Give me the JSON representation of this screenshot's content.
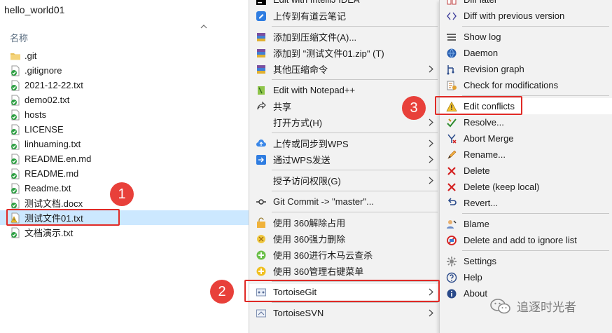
{
  "explorer": {
    "title": "hello_world01",
    "column_name": "名称",
    "files": [
      {
        "name": ".git",
        "icon": "folder-icon"
      },
      {
        "name": ".gitignore",
        "icon": "git-ok-icon"
      },
      {
        "name": "2021-12-22.txt",
        "icon": "git-ok-icon"
      },
      {
        "name": "demo02.txt",
        "icon": "git-ok-icon"
      },
      {
        "name": "hosts",
        "icon": "git-ok-icon"
      },
      {
        "name": "LICENSE",
        "icon": "git-ok-icon"
      },
      {
        "name": "linhuaming.txt",
        "icon": "git-ok-icon"
      },
      {
        "name": "README.en.md",
        "icon": "git-ok-icon"
      },
      {
        "name": "README.md",
        "icon": "git-ok-icon"
      },
      {
        "name": "Readme.txt",
        "icon": "git-ok-icon"
      },
      {
        "name": "测试文档.docx",
        "icon": "git-ok-icon"
      },
      {
        "name": "测试文件01.txt",
        "icon": "git-conflict-icon",
        "selected": true
      },
      {
        "name": "文档演示.txt",
        "icon": "git-ok-icon"
      }
    ]
  },
  "context_menu": {
    "items": [
      {
        "label": "Edit with IntelliJ IDEA",
        "icon": "intellij-icon"
      },
      {
        "label": "上传到有道云笔记",
        "icon": "youdao-icon"
      },
      {
        "sep": true
      },
      {
        "label": "添加到压缩文件(A)...",
        "icon": "winrar-icon"
      },
      {
        "label": "添加到 \"测试文件01.zip\" (T)",
        "icon": "winrar-icon"
      },
      {
        "label": "其他压缩命令",
        "icon": "winrar-icon",
        "submenu": true
      },
      {
        "sep": true
      },
      {
        "label": "Edit with Notepad++",
        "icon": "notepadpp-icon"
      },
      {
        "label": "共享",
        "icon": "share-icon"
      },
      {
        "label": "打开方式(H)",
        "icon": "",
        "submenu": true
      },
      {
        "sep": true
      },
      {
        "label": "上传或同步到WPS",
        "icon": "wps-cloud-icon",
        "submenu": true
      },
      {
        "label": "通过WPS发送",
        "icon": "wps-send-icon",
        "submenu": true
      },
      {
        "sep": true
      },
      {
        "label": "授予访问权限(G)",
        "icon": "",
        "submenu": true
      },
      {
        "sep": true
      },
      {
        "label": "Git Commit -> \"master\"...",
        "icon": "git-commit-icon"
      },
      {
        "sep": true
      },
      {
        "label": "使用 360解除占用",
        "icon": "360-unlock-icon"
      },
      {
        "label": "使用 360强力删除",
        "icon": "360-delete-icon"
      },
      {
        "label": "使用 360进行木马云查杀",
        "icon": "360-scan-icon"
      },
      {
        "label": "使用 360管理右键菜单",
        "icon": "360-manage-icon"
      },
      {
        "sep": true
      },
      {
        "label": "TortoiseGit",
        "icon": "tortoisegit-icon",
        "submenu": true,
        "highlight": true
      },
      {
        "sep": true
      },
      {
        "label": "TortoiseSVN",
        "icon": "tortoisesvn-icon",
        "submenu": true
      }
    ]
  },
  "submenu": {
    "items": [
      {
        "label": "Diff later",
        "icon": "diff-icon"
      },
      {
        "label": "Diff with previous version",
        "icon": "diff-prev-icon"
      },
      {
        "sep": true
      },
      {
        "label": "Show log",
        "icon": "log-icon"
      },
      {
        "label": "Daemon",
        "icon": "daemon-icon"
      },
      {
        "label": "Revision graph",
        "icon": "revision-graph-icon"
      },
      {
        "label": "Check for modifications",
        "icon": "check-mods-icon"
      },
      {
        "sep": true
      },
      {
        "label": "Edit conflicts",
        "icon": "edit-conflicts-icon",
        "highlight": true
      },
      {
        "label": "Resolve...",
        "icon": "resolve-icon"
      },
      {
        "label": "Abort Merge",
        "icon": "abort-merge-icon"
      },
      {
        "label": "Rename...",
        "icon": "rename-icon"
      },
      {
        "label": "Delete",
        "icon": "delete-icon"
      },
      {
        "label": "Delete (keep local)",
        "icon": "delete-keep-icon"
      },
      {
        "label": "Revert...",
        "icon": "revert-icon"
      },
      {
        "sep": true
      },
      {
        "label": "Blame",
        "icon": "blame-icon"
      },
      {
        "label": "Delete and add to ignore list",
        "icon": "ignore-icon"
      },
      {
        "sep": true
      },
      {
        "label": "Settings",
        "icon": "settings-icon"
      },
      {
        "label": "Help",
        "icon": "help-icon"
      },
      {
        "label": "About",
        "icon": "about-icon"
      }
    ]
  },
  "annotations": {
    "step1": "1",
    "step2": "2",
    "step3": "3"
  },
  "watermark": {
    "text": "追逐时光者"
  },
  "colors": {
    "selection": "#cce8ff",
    "badge": "#e8403a",
    "menu_bg": "#f2f2f2",
    "git_ok": "#2ea043"
  }
}
